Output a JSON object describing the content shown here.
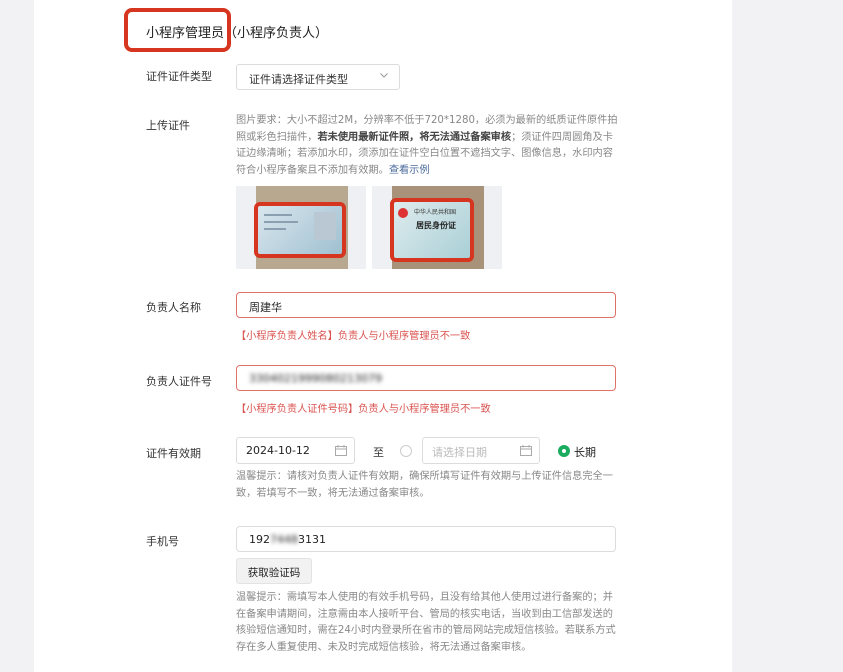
{
  "section": {
    "title": "小程序管理员",
    "subtitle": "（小程序负责人）"
  },
  "id_type": {
    "label": "证件证件类型",
    "select_value": "证件请选择证件类型",
    "icon": "chevron-down-icon"
  },
  "upload": {
    "label": "上传证件",
    "help_part1": "图片要求：大小不超过2M，分辨率不低于720*1280，必须为最新的纸质证件原件拍照或彩色扫描件，",
    "help_bold": "若未使用最新证件照，将无法通过备案审核",
    "help_part2": "；须证件四周圆角及卡证边缘清晰；若添加水印，须添加在证件空白位置不遮挡文字、图像信息，水印内容符合小程序备案且不添加有效期。",
    "help_link": "查看示例",
    "sample_front_text": "中华人民共和国",
    "sample_back_text": "居民身份证"
  },
  "name": {
    "label": "负责人名称",
    "value": "周建华",
    "error": "【小程序负责人姓名】负责人与小程序管理员不一致"
  },
  "id_number": {
    "label": "负责人证件号",
    "value": "3304021999080213079",
    "error": "【小程序负责人证件号码】负责人与小程序管理员不一致"
  },
  "validity": {
    "label": "证件有效期",
    "start_date": "2024-10-12",
    "to_label": "至",
    "end_placeholder": "请选择日期",
    "long_term_label": "长期",
    "long_term_selected": true,
    "help": "温馨提示：请核对负责人证件有效期，确保所填写证件有效期与上传证件信息完全一致，若填写不一致，将无法通过备案审核。"
  },
  "phone": {
    "label": "手机号",
    "value_prefix": "192",
    "value_hidden": "7448",
    "value_suffix": "3131",
    "verify_button": "获取验证码",
    "help": "温馨提示：需填写本人使用的有效手机号码，且没有给其他人使用过进行备案的；并在备案申请期间，注意需由本人接听平台、管局的核实电话，当收到由工信部发送的核验短信通知时，需在24小时内登录所在省市的管局网站完成短信核验。若联系方式存在多人重复使用、未及时完成短信核验，将无法通过备案审核。"
  },
  "colors": {
    "accent_green": "#1aad5f",
    "error_red": "#d9534f",
    "highlight_red": "#d6351f"
  }
}
